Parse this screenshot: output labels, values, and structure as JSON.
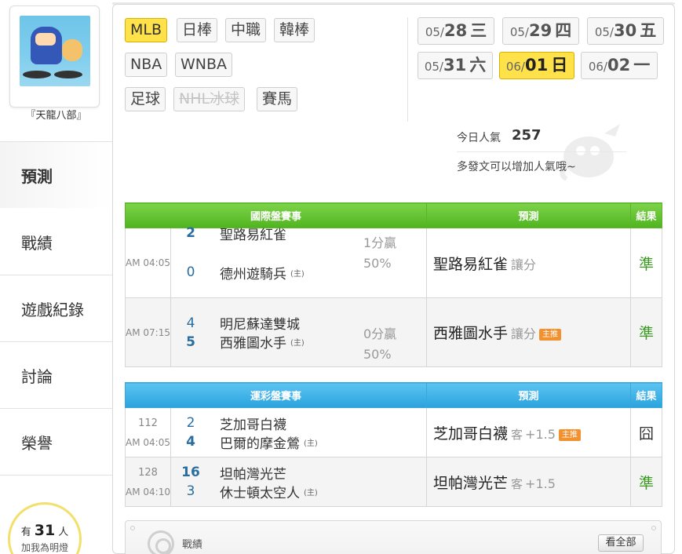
{
  "sidebar": {
    "nickname": "『天龍八部』",
    "nav": [
      {
        "label": "預測"
      },
      {
        "label": "戰績"
      },
      {
        "label": "遊戲紀錄"
      },
      {
        "label": "討論"
      },
      {
        "label": "榮譽"
      }
    ],
    "fans": {
      "prefix": "有",
      "count": "31",
      "suffix": "人",
      "line2": "加我為明燈"
    }
  },
  "leagues": {
    "mlb": "MLB",
    "npb": "日棒",
    "cpbl": "中職",
    "kbo": "韓棒",
    "nba": "NBA",
    "wnba": "WNBA",
    "soccer": "足球",
    "nhl": "NHL冰球",
    "horse": "賽馬"
  },
  "dates": [
    {
      "md": "05/",
      "d": "28",
      "w": "三"
    },
    {
      "md": "05/",
      "d": "29",
      "w": "四"
    },
    {
      "md": "05/",
      "d": "30",
      "w": "五"
    },
    {
      "md": "05/",
      "d": "31",
      "w": "六"
    },
    {
      "md": "06/",
      "d": "01",
      "w": "日"
    },
    {
      "md": "06/",
      "d": "02",
      "w": "一"
    }
  ],
  "popularity": {
    "label": "今日人氣",
    "value": "257",
    "note": "多發文可以增加人氣哦~"
  },
  "intl_table": {
    "headers": {
      "events": "國際盤賽事",
      "pred": "預測",
      "result": "結果"
    },
    "rows": [
      {
        "time": "AM 04:05",
        "away_score": "2",
        "away_team": "聖路易紅雀",
        "home_score": "0",
        "home_team": "德州遊騎兵",
        "home_mark": "(主)",
        "spread1": "1分贏",
        "spread2": "50%",
        "pick": "聖路易紅雀",
        "pick_type": "讓分",
        "result": "準"
      },
      {
        "time": "AM 07:15",
        "away_score": "4",
        "away_team": "明尼蘇達雙城",
        "home_score": "5",
        "home_team": "西雅圖水手",
        "home_mark": "(主)",
        "spread1": "0分贏",
        "spread2": "50%",
        "pick": "西雅圖水手",
        "pick_type": "讓分",
        "badge": "主推",
        "result": "準"
      }
    ]
  },
  "lottery_table": {
    "headers": {
      "events": "運彩盤賽事",
      "pred": "預測",
      "result": "結果"
    },
    "rows": [
      {
        "no": "112",
        "time": "AM 04:05",
        "away_score": "2",
        "away_team": "芝加哥白襪",
        "home_score": "4",
        "home_team": "巴爾的摩金鶯",
        "home_mark": "(主)",
        "pick": "芝加哥白襪",
        "pick_ab": "客",
        "pick_val": "+1.5",
        "badge": "主推",
        "result": "囧"
      },
      {
        "no": "128",
        "time": "AM 04:10",
        "away_score": "16",
        "away_team": "坦帕灣光芒",
        "home_score": "3",
        "home_team": "休士頓太空人",
        "home_mark": "(主)",
        "pick": "坦帕灣光芒",
        "pick_ab": "客",
        "pick_val": "+1.5",
        "result": "準"
      }
    ]
  },
  "record": {
    "title": "戰績",
    "view_all": "看全部"
  },
  "colors": {
    "accent_yellow": "#ffe14a",
    "green_header": "#4fb41e",
    "blue_header": "#2aa3dd",
    "result_good": "#3a9a22",
    "badge_orange": "#f4912f"
  }
}
